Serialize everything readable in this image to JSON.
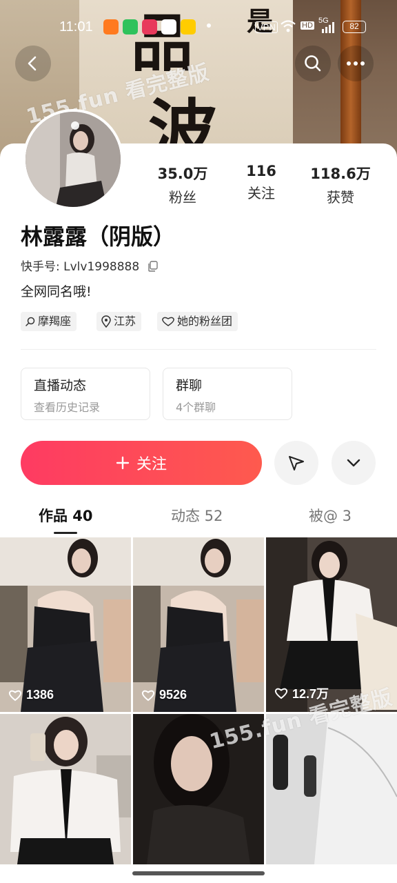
{
  "status_bar": {
    "time": "11:01",
    "vpn": "VPN",
    "hd": "HD",
    "network": "5G",
    "battery": "82"
  },
  "banner": {
    "calligraphy": [
      "品",
      "波",
      "是"
    ]
  },
  "watermarks": [
    "155.fun 看完整版",
    "155.fun 看完整版"
  ],
  "profile": {
    "name": "林露露（阴版）",
    "kuaishou_id": "快手号: Lvlv1998888",
    "bio": "全网同名哦!",
    "stats": [
      {
        "value": "35.0万",
        "label": "粉丝"
      },
      {
        "value": "116",
        "label": "关注"
      },
      {
        "value": "118.6万",
        "label": "获赞"
      }
    ],
    "tags": [
      {
        "icon": "search-icon",
        "label": "摩羯座"
      },
      {
        "icon": "location-icon",
        "label": "江苏"
      },
      {
        "icon": "heart-icon",
        "label": "她的粉丝团"
      }
    ]
  },
  "cards": [
    {
      "title": "直播动态",
      "subtitle": "查看历史记录"
    },
    {
      "title": "群聊",
      "subtitle": "4个群聊"
    }
  ],
  "actions": {
    "follow_label": "关注",
    "accent": "#fe4058"
  },
  "tabs": [
    {
      "label": "作品 40",
      "active": true
    },
    {
      "label": "动态 52",
      "active": false
    },
    {
      "label": "被@ 3",
      "active": false
    }
  ],
  "grid": [
    {
      "likes": "1386",
      "tone": "#b8a89a"
    },
    {
      "likes": "9526",
      "tone": "#b4a596"
    },
    {
      "likes": "12.7万",
      "tone": "#6d625b"
    },
    {
      "likes": "",
      "tone": "#d8d2cc"
    },
    {
      "likes": "",
      "tone": "#2a2422"
    },
    {
      "likes": "",
      "tone": "#e9e9e9"
    }
  ]
}
